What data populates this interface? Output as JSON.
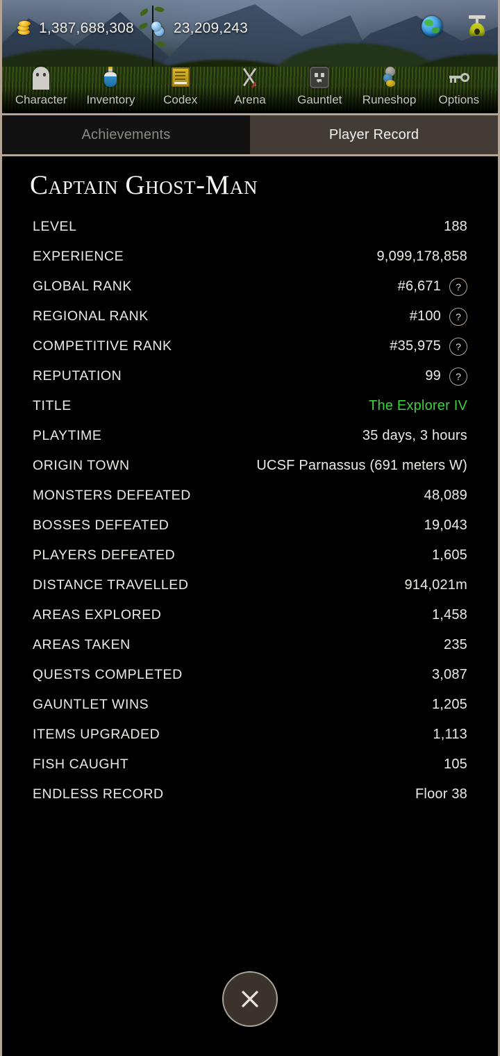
{
  "header": {
    "currencies": [
      {
        "icon": "gold-coin-icon",
        "value": "1,387,688,308"
      },
      {
        "icon": "gem-icon",
        "value": "23,209,243"
      }
    ],
    "actions": [
      {
        "icon": "globe-icon",
        "name": "world-map-button"
      },
      {
        "icon": "lamp-icon",
        "name": "lantern-button"
      }
    ]
  },
  "nav": {
    "items": [
      {
        "label": "Character",
        "icon": "ghost-icon"
      },
      {
        "label": "Inventory",
        "icon": "potion-icon"
      },
      {
        "label": "Codex",
        "icon": "book-icon"
      },
      {
        "label": "Arena",
        "icon": "crossed-swords-icon"
      },
      {
        "label": "Gauntlet",
        "icon": "skull-icon"
      },
      {
        "label": "Runeshop",
        "icon": "runes-icon"
      },
      {
        "label": "Options",
        "icon": "key-icon"
      }
    ]
  },
  "tabs": [
    {
      "label": "Achievements",
      "active": false
    },
    {
      "label": "Player Record",
      "active": true
    }
  ],
  "panel": {
    "player_name": "Captain Ghost-Man",
    "stats": [
      {
        "label": "LEVEL",
        "value": "188",
        "help": false
      },
      {
        "label": "EXPERIENCE",
        "value": "9,099,178,858",
        "help": false
      },
      {
        "label": "GLOBAL RANK",
        "value": "#6,671",
        "help": true
      },
      {
        "label": "REGIONAL RANK",
        "value": "#100",
        "help": true
      },
      {
        "label": "COMPETITIVE RANK",
        "value": "#35,975",
        "help": true
      },
      {
        "label": "REPUTATION",
        "value": "99",
        "help": true
      },
      {
        "label": "TITLE",
        "value": "The Explorer IV",
        "help": false,
        "accent": true
      },
      {
        "label": "PLAYTIME",
        "value": "35 days, 3 hours",
        "help": false
      },
      {
        "label": "ORIGIN TOWN",
        "value": "UCSF Parnassus (691 meters W)",
        "help": false
      },
      {
        "label": "MONSTERS DEFEATED",
        "value": "48,089",
        "help": false
      },
      {
        "label": "BOSSES DEFEATED",
        "value": "19,043",
        "help": false
      },
      {
        "label": "PLAYERS DEFEATED",
        "value": "1,605",
        "help": false
      },
      {
        "label": "DISTANCE TRAVELLED",
        "value": "914,021m",
        "help": false
      },
      {
        "label": "AREAS EXPLORED",
        "value": "1,458",
        "help": false
      },
      {
        "label": "AREAS TAKEN",
        "value": "235",
        "help": false
      },
      {
        "label": "QUESTS COMPLETED",
        "value": "3,087",
        "help": false
      },
      {
        "label": "GAUNTLET WINS",
        "value": "1,205",
        "help": false
      },
      {
        "label": "ITEMS UPGRADED",
        "value": "1,113",
        "help": false
      },
      {
        "label": "FISH CAUGHT",
        "value": "105",
        "help": false
      },
      {
        "label": "ENDLESS RECORD",
        "value": "Floor 38",
        "help": false
      }
    ],
    "help_badge_label": "?"
  },
  "close_button": {
    "icon": "close-icon",
    "name": "close-button"
  },
  "colors": {
    "accent_green": "#3dd13d",
    "border_tan": "#b5a595",
    "active_tab_bg": "#433b35",
    "inactive_tab_bg": "#121212",
    "panel_bg": "#000000",
    "text_primary": "#eceae4"
  }
}
